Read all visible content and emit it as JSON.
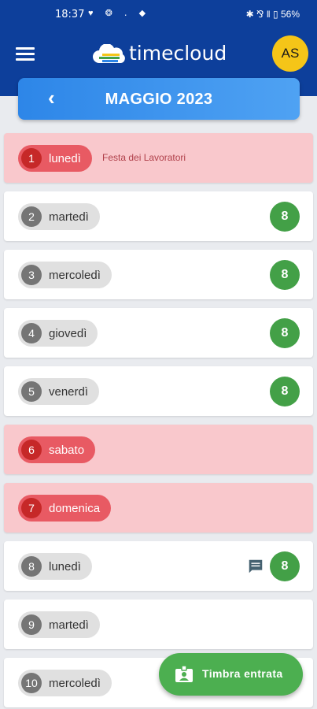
{
  "status_bar": {
    "time": "18:37",
    "notification_icons": "♥ ❂ ․ ◆",
    "right": "✱ ⅋ ‖ ▯ 56%"
  },
  "header": {
    "app_name": "timecloud",
    "avatar_initials": "AS"
  },
  "month": {
    "title": "MAGGIO 2023",
    "prev_symbol": "‹"
  },
  "days": [
    {
      "num": "1",
      "weekday": "lunedì",
      "holiday": true,
      "holiday_name": "Festa dei Lavoratori"
    },
    {
      "num": "2",
      "weekday": "martedì",
      "hours": "8"
    },
    {
      "num": "3",
      "weekday": "mercoledì",
      "hours": "8"
    },
    {
      "num": "4",
      "weekday": "giovedì",
      "hours": "8"
    },
    {
      "num": "5",
      "weekday": "venerdì",
      "hours": "8"
    },
    {
      "num": "6",
      "weekday": "sabato",
      "holiday": true
    },
    {
      "num": "7",
      "weekday": "domenica",
      "holiday": true
    },
    {
      "num": "8",
      "weekday": "lunedì",
      "hours": "8",
      "comment": true
    },
    {
      "num": "9",
      "weekday": "martedì"
    },
    {
      "num": "10",
      "weekday": "mercoledì"
    }
  ],
  "fab": {
    "label": "Timbra entrata",
    "icon": "badge-icon"
  },
  "colors": {
    "primary": "#0d3f9b",
    "accent_blue": "#2d86e8",
    "holiday_bg": "#f9c8cc",
    "hours_green": "#43a047",
    "avatar": "#f5c518"
  }
}
